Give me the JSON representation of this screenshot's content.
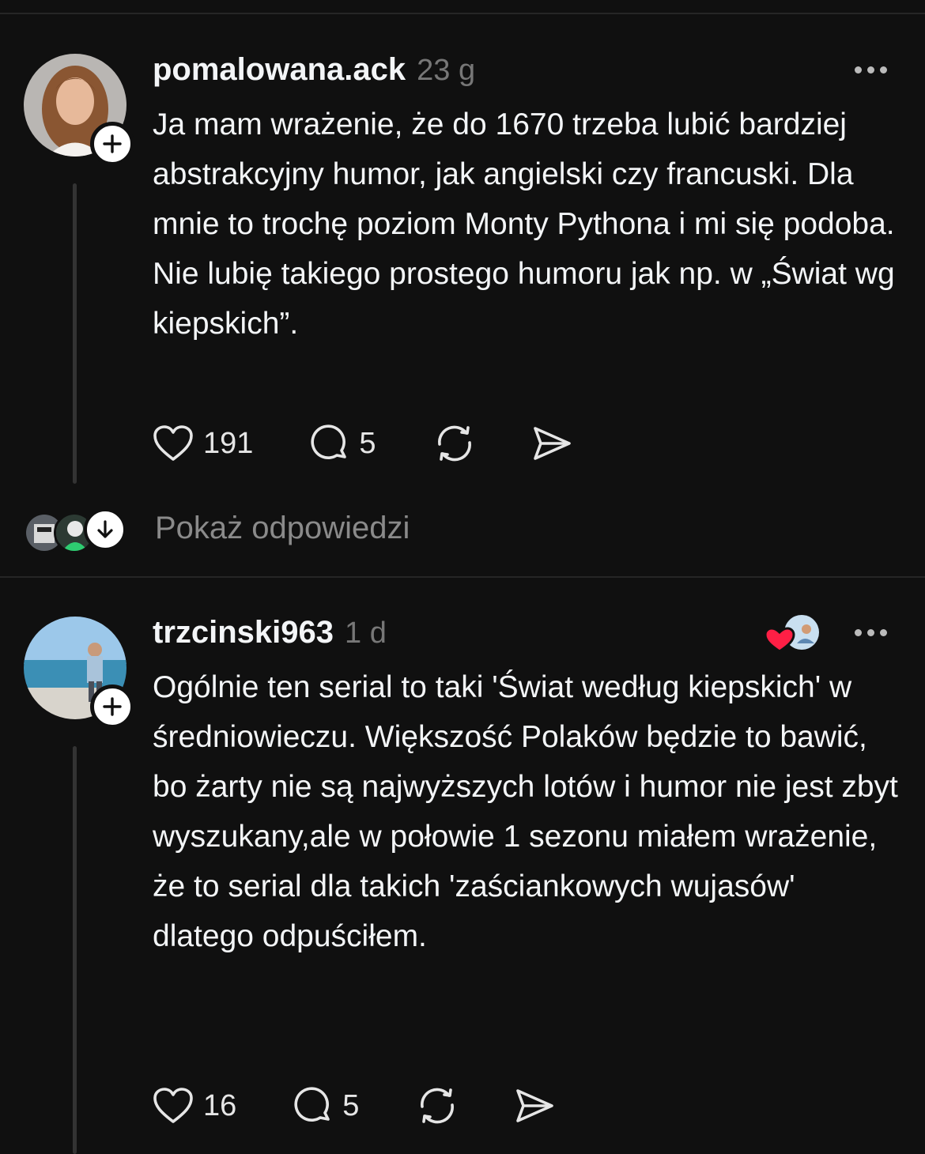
{
  "posts": [
    {
      "username": "pomalowana.ack",
      "time": "23 g",
      "text": "Ja mam wrażenie, że do 1670 trzeba lubić bardziej abstrakcyjny humor, jak angielski czy francuski. Dla mnie to trochę poziom Monty Pythona i mi się podoba. Nie lubię takiego prostego humoru jak np. w „Świat wg kiepskich”.",
      "likes": "191",
      "comments": "5"
    },
    {
      "username": "trzcinski963",
      "time": "1 d",
      "text": "Ogólnie ten serial to taki 'Świat według kiepskich' w średniowieczu. Większość Polaków będzie to bawić, bo żarty nie są najwyższych lotów i humor nie jest zbyt wyszukany,ale w połowie 1 sezonu miałem wrażenie, że to serial dla takich 'zaściankowych wujasów' dlatego odpuściłem.",
      "likes": "16",
      "comments": "5"
    }
  ],
  "show_replies_label": "Pokaż odpowiedzi",
  "icons": [
    "plus-icon",
    "more-icon",
    "heart-icon",
    "comment-icon",
    "repost-icon",
    "share-icon",
    "arrow-down-icon"
  ]
}
